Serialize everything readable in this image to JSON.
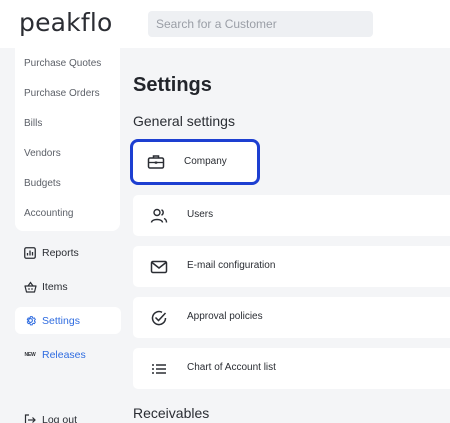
{
  "app": {
    "logo": "peakflo"
  },
  "search": {
    "placeholder": "Search for a Customer"
  },
  "sidebar": {
    "sub_items": [
      "Purchase Quotes",
      "Purchase Orders",
      "Bills",
      "Vendors",
      "Budgets",
      "Accounting"
    ],
    "nav": {
      "reports": "Reports",
      "items": "Items",
      "settings": "Settings",
      "releases_badge": "NEW",
      "releases": "Releases",
      "logout": "Log out"
    }
  },
  "main": {
    "title": "Settings",
    "general_heading": "General settings",
    "receivables_heading": "Receivables",
    "cards": {
      "company": "Company",
      "users": "Users",
      "email": "E-mail configuration",
      "approval": "Approval policies",
      "coa": "Chart of Account list"
    }
  },
  "colors": {
    "accent": "#2f6ce0",
    "focus_ring": "#1d3fd1",
    "background": "#f4f5f7"
  }
}
